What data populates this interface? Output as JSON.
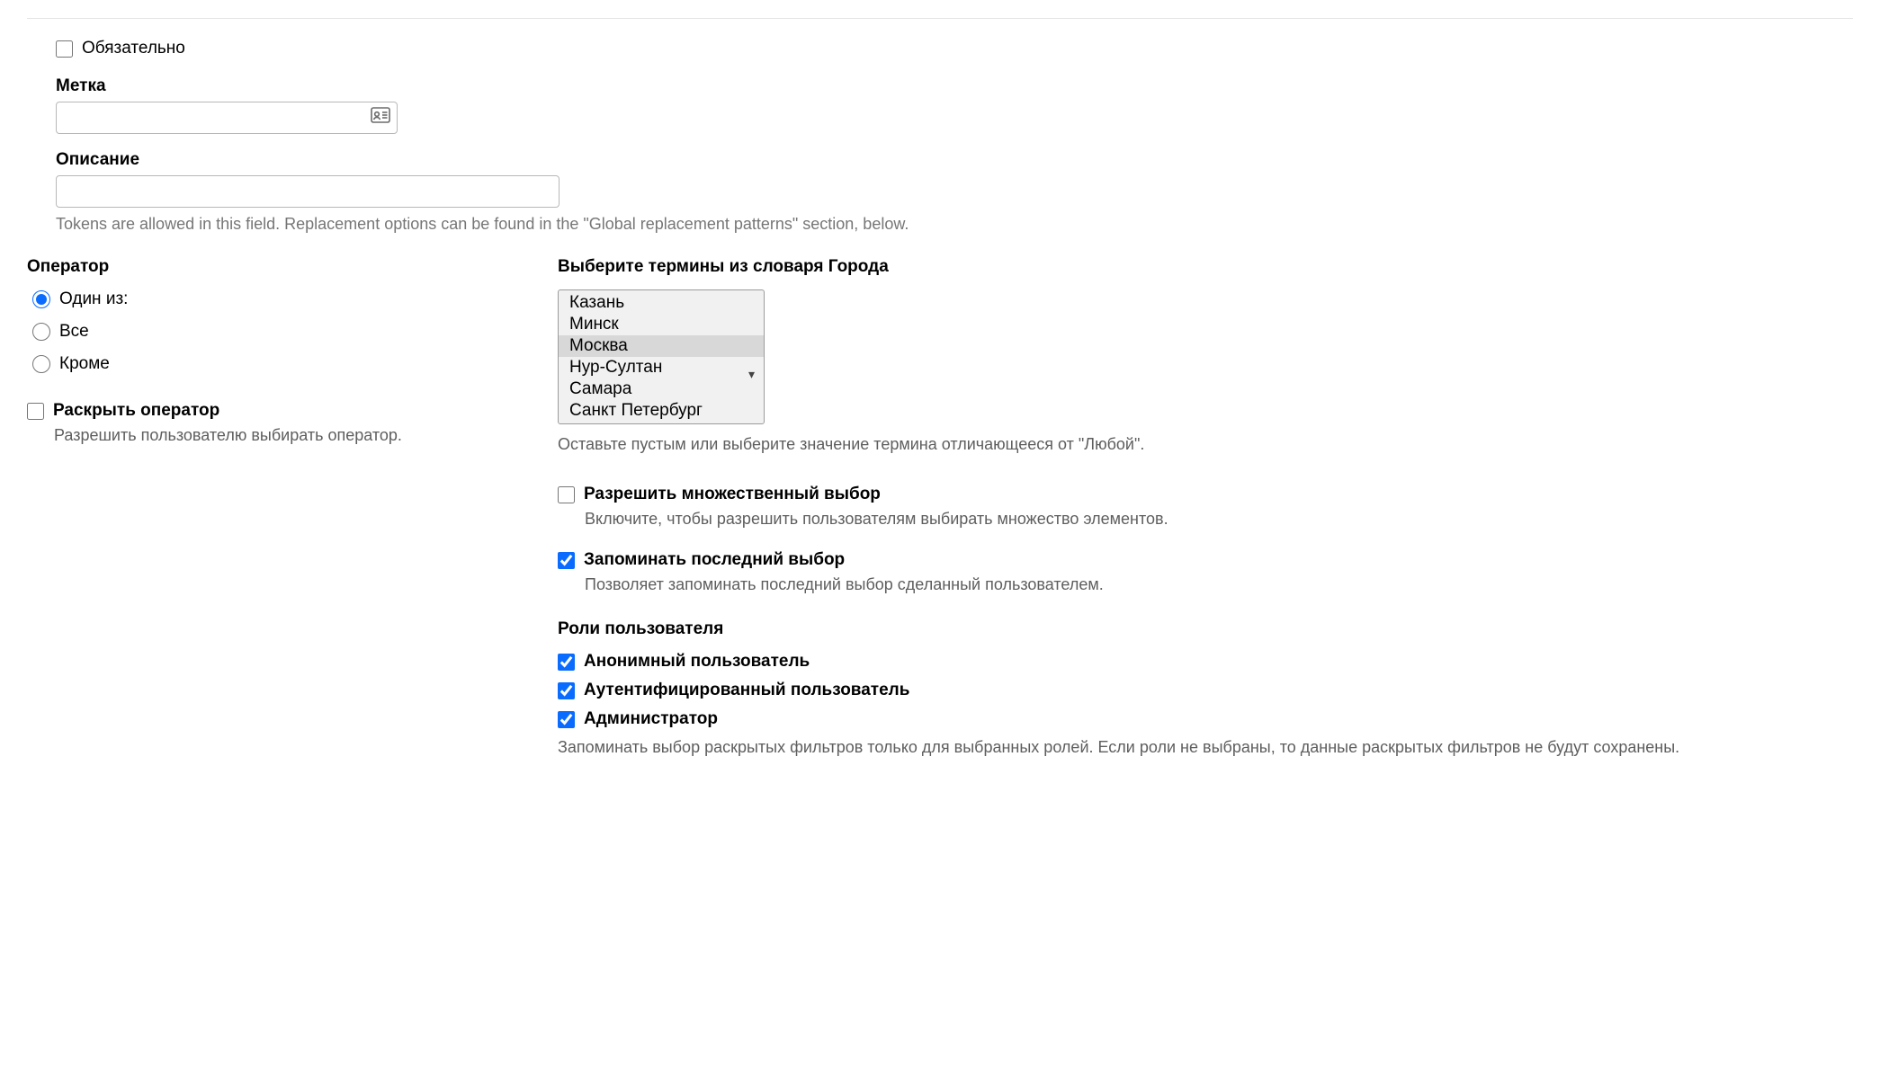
{
  "top": {
    "required_label": "Обязательно",
    "required_checked": false,
    "label_field_label": "Метка",
    "label_field_value": "",
    "desc_field_label": "Описание",
    "desc_field_value": "",
    "tokens_hint": "Tokens are allowed in this field. Replacement options can be found in the \"Global replacement patterns\" section, below."
  },
  "operator": {
    "title": "Оператор",
    "options": [
      "Один из:",
      "Все",
      "Кроме"
    ],
    "selected": 0,
    "expose_label": "Раскрыть оператор",
    "expose_checked": false,
    "expose_desc": "Разрешить пользователю выбирать оператор."
  },
  "terms": {
    "title": "Выберите термины из словаря Города",
    "items": [
      "Казань",
      "Минск",
      "Москва",
      "Нур-Султан",
      "Самара",
      "Санкт Петербург"
    ],
    "selected_index": 2,
    "hint": "Оставьте пустым или выберите значение термина отличающееся от \"Любой\".",
    "allow_multi_label": "Разрешить множественный выбор",
    "allow_multi_checked": false,
    "allow_multi_desc": "Включите, чтобы разрешить пользователям выбирать множество элементов.",
    "remember_label": "Запоминать последний выбор",
    "remember_checked": true,
    "remember_desc": "Позволяет запоминать последний выбор сделанный пользователем."
  },
  "roles": {
    "title": "Роли пользователя",
    "items": [
      {
        "label": "Анонимный пользователь",
        "checked": true
      },
      {
        "label": "Аутентифицированный пользователь",
        "checked": true
      },
      {
        "label": "Администратор",
        "checked": true
      }
    ],
    "hint": "Запоминать выбор раскрытых фильтров только для выбранных ролей. Если роли не выбраны, то данные раскрытых фильтров не будут сохранены."
  }
}
